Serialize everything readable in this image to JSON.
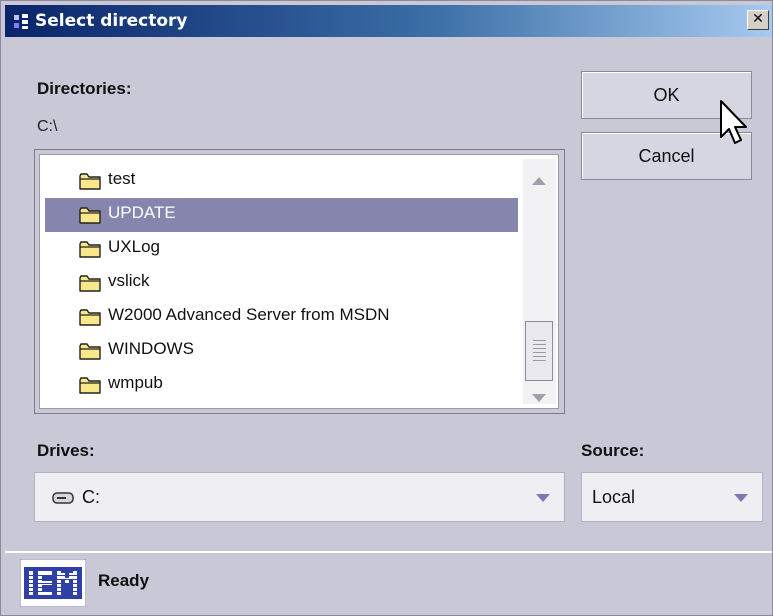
{
  "window": {
    "title": "Select directory",
    "close_label": "✕"
  },
  "directories": {
    "label": "Directories:",
    "current_path": "C:\\",
    "items": [
      {
        "label": "test",
        "selected": false
      },
      {
        "label": "UPDATE",
        "selected": true
      },
      {
        "label": "UXLog",
        "selected": false
      },
      {
        "label": "vslick",
        "selected": false
      },
      {
        "label": "W2000 Advanced Server from MSDN",
        "selected": false
      },
      {
        "label": "WINDOWS",
        "selected": false
      },
      {
        "label": "wmpub",
        "selected": false
      }
    ]
  },
  "buttons": {
    "ok_label": "OK",
    "cancel_label": "Cancel"
  },
  "drives": {
    "label": "Drives:",
    "value": "C:"
  },
  "source": {
    "label": "Source:",
    "value": "Local"
  },
  "status": {
    "logo_text": "IBM",
    "text": "Ready"
  },
  "colors": {
    "selection": "#8585ad",
    "titlebar_start": "#0a246a",
    "titlebar_end": "#a6caf0",
    "dialog_bg": "#c8c8d6"
  }
}
